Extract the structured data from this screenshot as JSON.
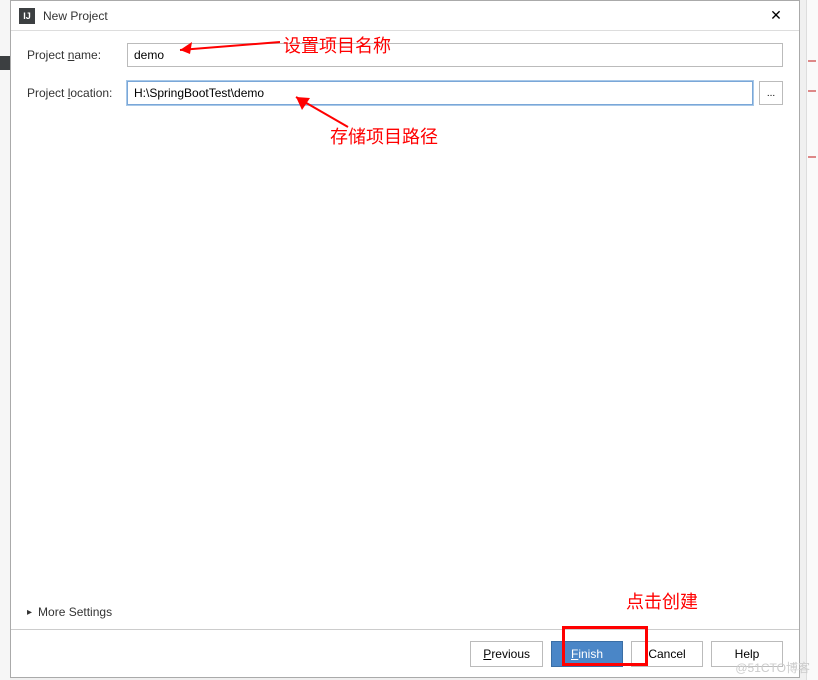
{
  "titlebar": {
    "title": "New Project",
    "app_icon_text": "IJ"
  },
  "form": {
    "name_label_pre": "Project ",
    "name_label_mn": "n",
    "name_label_post": "ame:",
    "name_value": "demo",
    "location_label_pre": "Project ",
    "location_label_mn": "l",
    "location_label_post": "ocation:",
    "location_value": "H:\\SpringBootTest\\demo",
    "browse_label": "..."
  },
  "more_settings": {
    "label": "More Settings",
    "chevron": "▸"
  },
  "footer": {
    "previous_mn": "P",
    "previous_post": "revious",
    "finish_mn": "F",
    "finish_post": "inish",
    "cancel": "Cancel",
    "help": "Help"
  },
  "annotations": {
    "set_name": "设置项目名称",
    "save_path": "存储项目路径",
    "click_create": "点击创建"
  },
  "watermark": "@51CTO博客"
}
